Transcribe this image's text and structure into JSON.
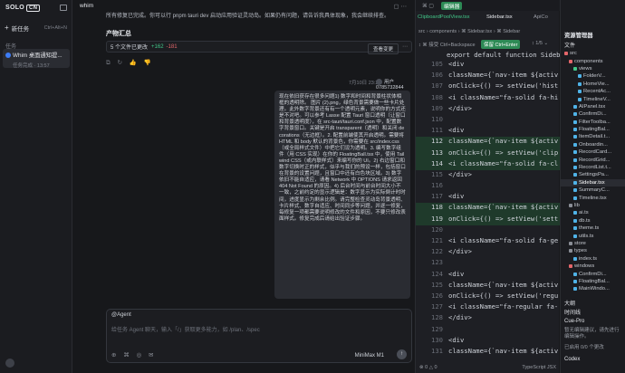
{
  "sidebar": {
    "logo": "SOLO",
    "logo_badge": "CN",
    "new_task": "新任务",
    "new_task_shortcut": "Ctrl+Alt+N",
    "section": "任务",
    "task": {
      "title": "Whim 桌面通知提...",
      "status": "任务完成 · 13:57"
    }
  },
  "chat": {
    "header_title": "whim",
    "header_icons": "▢ ⋯",
    "intro": "所有修复已完成。你可以行 pnpm tauri dev 启动应用验证灵动岛。如果仍有问题，请告诉我具体现象，我会继续排查。",
    "summary_title": "产物汇总",
    "files_changed": "5 个文件已更改",
    "additions": "+162",
    "deletions": "-181",
    "view_changes": "查看变更",
    "timestamp": "7月10日 23:25",
    "user": "用户0785732844",
    "message": "现在依旧获存在很多问题1) 数字和时间和背景柱状体相框的透明除。 图片 (2).png，绿色背景需要做一些卡片处理。此外数字背景还有有一个透明元素，说明你的方式还是不对吧。可以参考 Lasse 配置 Tauri 窗口透明（让窗口和背景透明度），在 src-tauri/tauri.conf.json 中，配置数字背景窗口。关键是开启 transparent（透明）和关闭 decorations（无边框）。2. 配置前端使其开启透明。需要将 HTML 和 body 默认的背景色，你需要在 src/index.css（或全局样式文件）中把它们设为透明。3. 编写数字组件（用 CSS 实现）在你的 FloatingBall.tsx 中，使用 Tailwind CSS（或内联样式）来编写你的 UI。2) 右边窗口和数字切换时正的样式，似乎与我们的预设一样，包括窗口在背景的设置问题，且窗口中还有白色块区域。3) 数字依旧不能自适应，请看 Network 中 OPTIONS 请求返回 404 Not Found 的原因。4) 后台时间与前台时间大小不一致，之前约定的显示逻辑是：数字显示为实际倒计时时间，进度显示为剩余比例。请完整检查灵动岛背景透明、卡片样式、数字自适应、时间同步等问题，并逐一修复，每修复一项都需要说明修改的文件和原因，不要只修改表面样式。修复完成后请给出验证步骤。"
  },
  "composer": {
    "agent": "@Agent",
    "placeholder": "给任务 Agent 聊天，输入「/」获取更多能力，如 /plan、/spec",
    "tools": "⊕ ⌘ ◎ ✉",
    "model": "MiniMax M1",
    "send": "↑"
  },
  "editor": {
    "tab_active": "编辑器",
    "tab_other": "⌘ ▢",
    "file_tabs": [
      "ClipboardPoolView.tsx",
      "Sidebar.tsx",
      "ApiCo"
    ],
    "breadcrumb": "src › components › ⌘ Sidebar.tsx › ⌘ Sidebar",
    "find_left": "↕ ⌘ 接受  Ctrl+Backspace",
    "keep": "保留  Ctrl+Enter",
    "find_right": "↕ 1/5 ⌄",
    "function_head": "export default function Sidebar(",
    "lines": [
      {
        "n": "105",
        "txt": "<div",
        "hl": false
      },
      {
        "n": "106",
        "txt": "  className={`nav-item ${activ",
        "hl": false
      },
      {
        "n": "107",
        "txt": "  onClick={() => setView('hist",
        "hl": false
      },
      {
        "n": "108",
        "txt": "  <i className=\"fa-solid fa-hi",
        "hl": false
      },
      {
        "n": "109",
        "txt": "</div>",
        "hl": false
      },
      {
        "n": "110",
        "txt": "",
        "hl": false
      },
      {
        "n": "111",
        "txt": "<div",
        "hl": false
      },
      {
        "n": "112",
        "txt": "  className={`nav-item ${activ",
        "hl": true
      },
      {
        "n": "113",
        "txt": "  onClick={() => setView('clip",
        "hl": true
      },
      {
        "n": "114",
        "txt": "  <i className=\"fa-solid fa-cl",
        "hl": true
      },
      {
        "n": "115",
        "txt": "</div>",
        "hl": false
      },
      {
        "n": "116",
        "txt": "",
        "hl": false
      },
      {
        "n": "117",
        "txt": "<div",
        "hl": false
      },
      {
        "n": "118",
        "txt": "  className={`nav-item ${activ",
        "hl": true
      },
      {
        "n": "119",
        "txt": "  onClick={() => setView('sett",
        "hl": true
      },
      {
        "n": "120",
        "txt": "",
        "hl": false
      },
      {
        "n": "121",
        "txt": "  <i className=\"fa-solid fa-ge",
        "hl": false
      },
      {
        "n": "122",
        "txt": "</div>",
        "hl": false
      },
      {
        "n": "123",
        "txt": "",
        "hl": false
      },
      {
        "n": "124",
        "txt": "<div",
        "hl": false
      },
      {
        "n": "125",
        "txt": "  className={`nav-item ${activ",
        "hl": false
      },
      {
        "n": "126",
        "txt": "  onClick={() => setView('regu",
        "hl": false
      },
      {
        "n": "127",
        "txt": "  <i className=\"fa-regular fa-",
        "hl": false
      },
      {
        "n": "128",
        "txt": "</div>",
        "hl": false
      },
      {
        "n": "129",
        "txt": "",
        "hl": false
      },
      {
        "n": "130",
        "txt": "<div",
        "hl": false
      },
      {
        "n": "131",
        "txt": "  className={`nav-item ${activ",
        "hl": false
      }
    ],
    "status_left": "⊗ 0  △ 0",
    "status_right": "TypeScript JSX"
  },
  "explorer": {
    "title": "资源管理器",
    "section_files": "文件",
    "tree": [
      {
        "name": "src",
        "depth": 0,
        "color": "#e4666a"
      },
      {
        "name": "components",
        "depth": 1,
        "color": "#e4666a"
      },
      {
        "name": "views",
        "depth": 2,
        "color": "#42c98a"
      },
      {
        "name": "FolderV...",
        "depth": 3,
        "color": "#4fb3e8"
      },
      {
        "name": "HomeVie...",
        "depth": 3,
        "color": "#4fb3e8"
      },
      {
        "name": "RecentAc...",
        "depth": 3,
        "color": "#4fb3e8"
      },
      {
        "name": "TimelineV...",
        "depth": 3,
        "color": "#4fb3e8"
      },
      {
        "name": "AIPanel.tsx",
        "depth": 2,
        "color": "#4fb3e8"
      },
      {
        "name": "ConfirmDi...",
        "depth": 2,
        "color": "#4fb3e8"
      },
      {
        "name": "FilterToolba...",
        "depth": 2,
        "color": "#4fb3e8"
      },
      {
        "name": "FloatingBal...",
        "depth": 2,
        "color": "#4fb3e8"
      },
      {
        "name": "ItemDetail.t...",
        "depth": 2,
        "color": "#4fb3e8"
      },
      {
        "name": "Onboardin...",
        "depth": 2,
        "color": "#4fb3e8"
      },
      {
        "name": "RecordCard...",
        "depth": 2,
        "color": "#4fb3e8"
      },
      {
        "name": "RecordGrid...",
        "depth": 2,
        "color": "#4fb3e8"
      },
      {
        "name": "RecordList.t...",
        "depth": 2,
        "color": "#4fb3e8"
      },
      {
        "name": "SettingsPa...",
        "depth": 2,
        "color": "#4fb3e8"
      },
      {
        "name": "Sidebar.tsx",
        "depth": 2,
        "color": "#4fb3e8"
      },
      {
        "name": "SummaryC...",
        "depth": 2,
        "color": "#4fb3e8"
      },
      {
        "name": "Timeline.tsx",
        "depth": 2,
        "color": "#4fb3e8"
      },
      {
        "name": "lib",
        "depth": 1,
        "color": "#8a8e96"
      },
      {
        "name": "ai.ts",
        "depth": 2,
        "color": "#4fb3e8"
      },
      {
        "name": "db.ts",
        "depth": 2,
        "color": "#4fb3e8"
      },
      {
        "name": "theme.ts",
        "depth": 2,
        "color": "#4fb3e8"
      },
      {
        "name": "utils.ts",
        "depth": 2,
        "color": "#4fb3e8"
      },
      {
        "name": "store",
        "depth": 1,
        "color": "#8a8e96"
      },
      {
        "name": "types",
        "depth": 1,
        "color": "#8a8e96"
      },
      {
        "name": "index.ts",
        "depth": 2,
        "color": "#4fb3e8"
      },
      {
        "name": "windows",
        "depth": 1,
        "color": "#e4666a"
      },
      {
        "name": "ConfirmDi...",
        "depth": 2,
        "color": "#4fb3e8"
      },
      {
        "name": "FloatingBal...",
        "depth": 2,
        "color": "#4fb3e8"
      },
      {
        "name": "MainWindo...",
        "depth": 2,
        "color": "#4fb3e8"
      }
    ],
    "outline": "大纲",
    "timeline": "时间线",
    "panel_title": "Cue-Pro",
    "panel_text": "暂无编辑建议，请先进行编辑操作。",
    "panel_status": "已启用 0/0 个更改",
    "codex": "Codex"
  },
  "colors": {
    "accent_green": "#2d8a55",
    "add": "#42c98a",
    "del": "#e4666a"
  }
}
